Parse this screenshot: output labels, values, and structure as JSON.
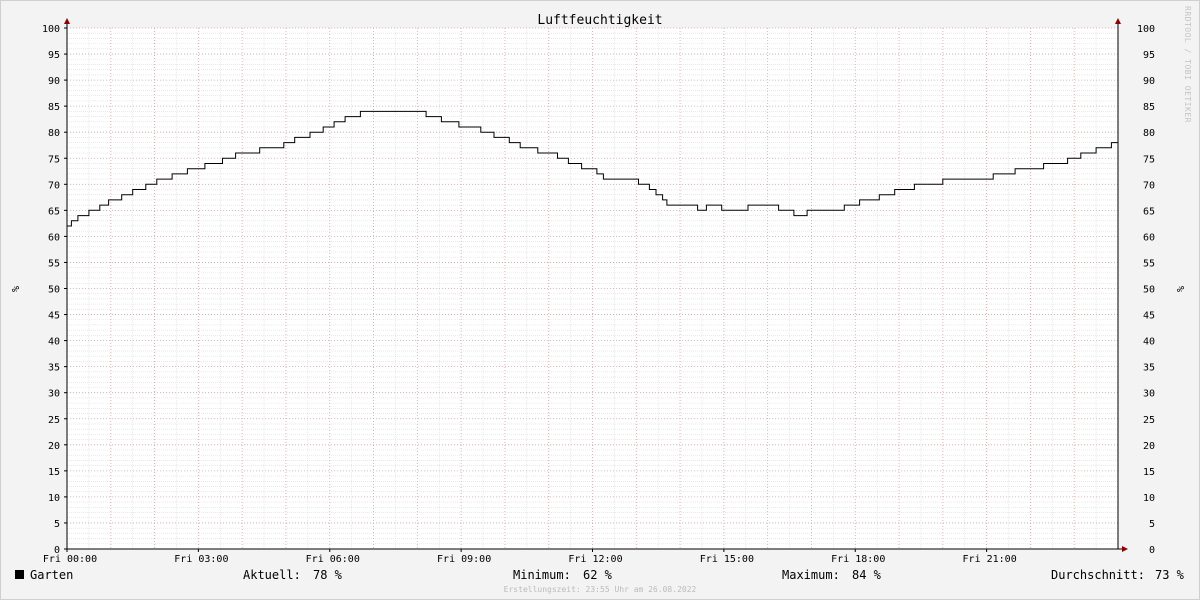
{
  "chart_data": {
    "type": "line",
    "title": "Luftfeuchtigkeit",
    "ylabel": "%",
    "y2label": "%",
    "ylim": [
      0,
      100
    ],
    "y_ticks": [
      0,
      5,
      10,
      15,
      20,
      25,
      30,
      35,
      40,
      45,
      50,
      55,
      60,
      65,
      70,
      75,
      80,
      85,
      90,
      95,
      100
    ],
    "xlim_hours": [
      0,
      24
    ],
    "x_ticks": [
      {
        "hour": 0,
        "label": "Fri 00:00"
      },
      {
        "hour": 3,
        "label": "Fri 03:00"
      },
      {
        "hour": 6,
        "label": "Fri 06:00"
      },
      {
        "hour": 9,
        "label": "Fri 09:00"
      },
      {
        "hour": 12,
        "label": "Fri 12:00"
      },
      {
        "hour": 15,
        "label": "Fri 15:00"
      },
      {
        "hour": 18,
        "label": "Fri 18:00"
      },
      {
        "hour": 21,
        "label": "Fri 21:00"
      }
    ],
    "grid": true,
    "series": [
      {
        "name": "Garten",
        "color": "#000000",
        "points": [
          [
            0.0,
            62
          ],
          [
            0.1,
            63
          ],
          [
            0.25,
            64
          ],
          [
            0.5,
            65
          ],
          [
            0.75,
            66
          ],
          [
            0.95,
            67
          ],
          [
            1.25,
            68
          ],
          [
            1.5,
            69
          ],
          [
            1.8,
            70
          ],
          [
            2.05,
            71
          ],
          [
            2.4,
            72
          ],
          [
            2.75,
            73
          ],
          [
            3.15,
            74
          ],
          [
            3.55,
            75
          ],
          [
            3.85,
            76
          ],
          [
            4.4,
            77
          ],
          [
            4.95,
            78
          ],
          [
            5.2,
            79
          ],
          [
            5.55,
            80
          ],
          [
            5.85,
            81
          ],
          [
            6.1,
            82
          ],
          [
            6.35,
            83
          ],
          [
            6.7,
            84
          ],
          [
            8.2,
            83
          ],
          [
            8.55,
            82
          ],
          [
            8.95,
            81
          ],
          [
            9.45,
            80
          ],
          [
            9.75,
            79
          ],
          [
            10.1,
            78
          ],
          [
            10.35,
            77
          ],
          [
            10.75,
            76
          ],
          [
            11.2,
            75
          ],
          [
            11.45,
            74
          ],
          [
            11.75,
            73
          ],
          [
            12.1,
            72
          ],
          [
            12.25,
            71
          ],
          [
            13.05,
            70
          ],
          [
            13.3,
            69
          ],
          [
            13.45,
            68
          ],
          [
            13.6,
            67
          ],
          [
            13.7,
            66
          ],
          [
            14.4,
            65
          ],
          [
            14.6,
            66
          ],
          [
            14.95,
            65
          ],
          [
            15.55,
            66
          ],
          [
            16.25,
            65
          ],
          [
            16.6,
            64
          ],
          [
            16.9,
            65
          ],
          [
            17.75,
            66
          ],
          [
            18.1,
            67
          ],
          [
            18.55,
            68
          ],
          [
            18.9,
            69
          ],
          [
            19.35,
            70
          ],
          [
            20.0,
            71
          ],
          [
            21.15,
            72
          ],
          [
            21.65,
            73
          ],
          [
            22.3,
            74
          ],
          [
            22.85,
            75
          ],
          [
            23.15,
            76
          ],
          [
            23.5,
            77
          ],
          [
            23.85,
            78
          ],
          [
            24.0,
            78
          ]
        ]
      }
    ],
    "legend": {
      "series_label": "Garten",
      "current_label": "Aktuell:",
      "current_value": "78 %",
      "min_label": "Minimum:",
      "min_value": "62 %",
      "max_label": "Maximum:",
      "max_value": "84 %",
      "avg_label": "Durchschnitt:",
      "avg_value": "73 %"
    },
    "footer": "Erstellungszeit: 23:55 Uhr am 26.08.2022",
    "watermark": "RRDTOOL / TOBI OETIKER"
  }
}
